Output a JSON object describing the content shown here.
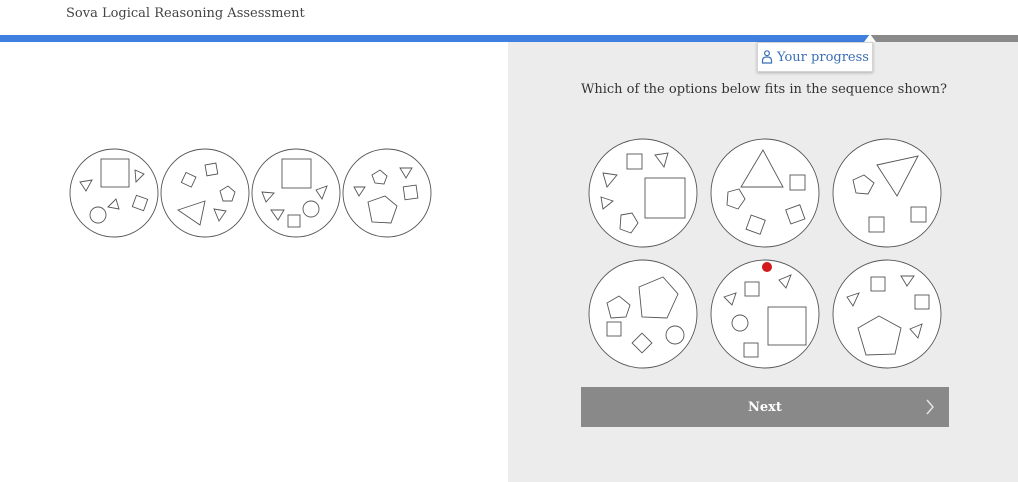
{
  "app": {
    "title": "Sova Logical Reasoning Assessment"
  },
  "progress": {
    "fraction": 0.855,
    "button_label": "Your progress",
    "icon": "person-icon"
  },
  "question": {
    "text": "Which of the options below fits in the sequence shown?"
  },
  "sequence": {
    "count": 4
  },
  "options": {
    "count": 6
  },
  "navigation": {
    "next_label": "Next",
    "next_icon": "chevron-right-icon"
  },
  "colors": {
    "accent": "#3f7fe0",
    "track": "#8a8a8a",
    "right_pane": "#ececec",
    "next_button": "#898989",
    "link": "#3a6fb7"
  }
}
